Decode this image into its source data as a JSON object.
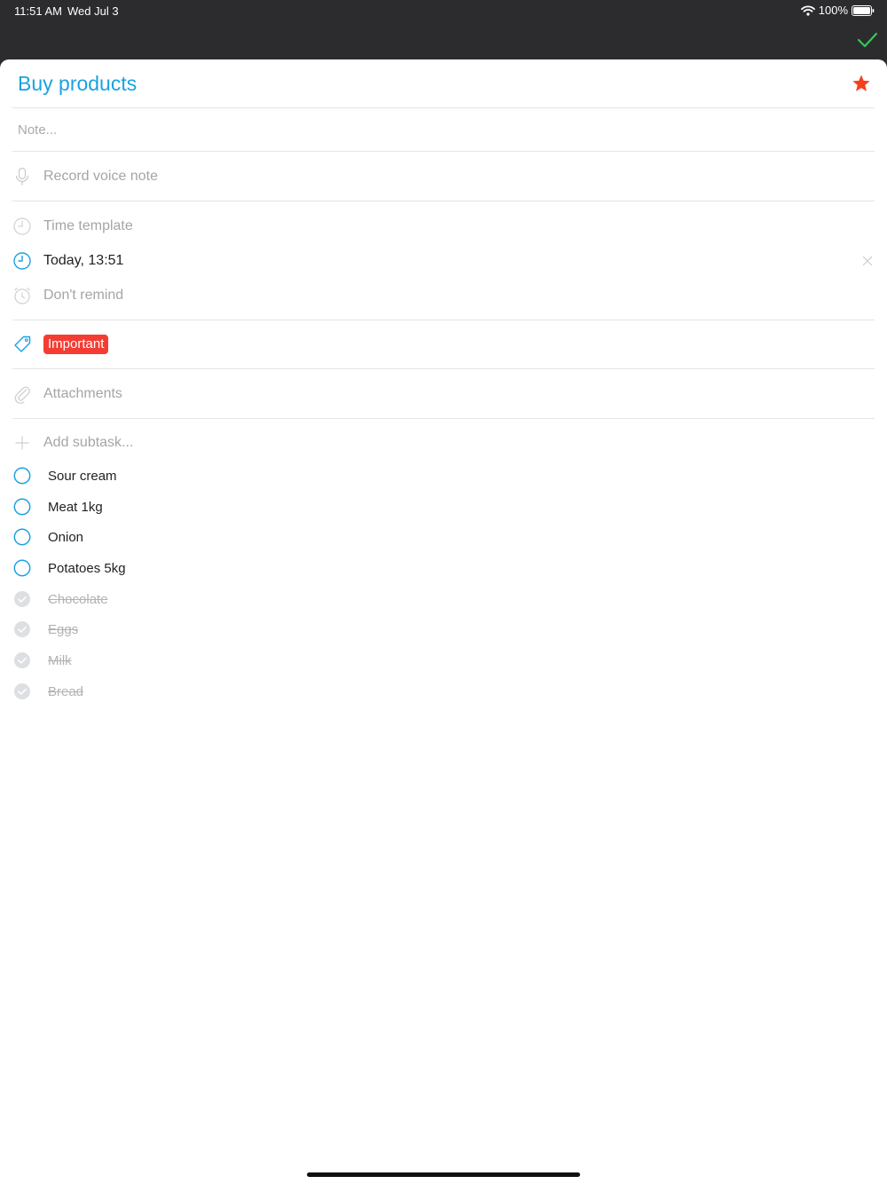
{
  "status_bar": {
    "time": "11:51 AM",
    "date": "Wed Jul 3",
    "battery": "100%"
  },
  "task": {
    "title": "Buy products",
    "note_placeholder": "Note...",
    "voice_note_label": "Record voice note",
    "time_template_label": "Time template",
    "due_label": "Today, 13:51",
    "reminder_label": "Don't remind",
    "tag_label": "Important",
    "attachments_label": "Attachments",
    "add_subtask_label": "Add subtask..."
  },
  "subtasks": [
    {
      "label": "Sour cream",
      "done": false
    },
    {
      "label": "Meat 1kg",
      "done": false
    },
    {
      "label": "Onion",
      "done": false
    },
    {
      "label": "Potatoes 5kg",
      "done": false
    },
    {
      "label": "Chocolate",
      "done": true
    },
    {
      "label": "Eggs",
      "done": true
    },
    {
      "label": "Milk",
      "done": true
    },
    {
      "label": "Bread",
      "done": true
    }
  ],
  "colors": {
    "accent": "#1ba1e2",
    "star": "#f4401c",
    "tag": "#f43c33",
    "done_check": "#35c759",
    "top_bar": "#2c2c2e"
  },
  "icons": {
    "done": "checkmark-icon",
    "favorite": "star-icon",
    "voice": "microphone-icon",
    "time_template": "clock-icon",
    "due": "clock-icon",
    "reminder": "alarm-icon",
    "tag": "tag-icon",
    "attachments": "paperclip-icon",
    "add": "plus-icon"
  }
}
